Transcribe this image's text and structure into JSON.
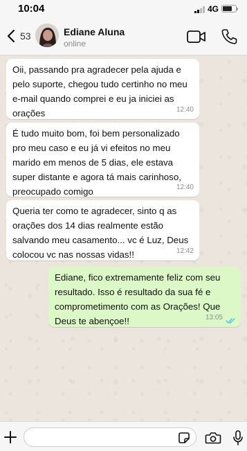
{
  "status_bar": {
    "time": "10:04",
    "network": "4G",
    "battery_level": 0.7
  },
  "header": {
    "back_count": "53",
    "contact_name": "Ediane Aluna",
    "contact_status": "online",
    "icons": [
      "chevron-left-icon",
      "video-camera-icon",
      "phone-icon"
    ]
  },
  "messages": [
    {
      "direction": "incoming",
      "text": "Oii, passando pra agradecer pela ajuda e pelo suporte, chegou tudo certinho no meu e-mail quando comprei e eu ja iniciei as orações",
      "time": "12:40"
    },
    {
      "direction": "incoming",
      "text": "É tudo muito bom, foi bem personalizado pro meu caso e eu já vi efeitos no meu marido em menos de 5 dias, ele estava super distante e agora tá mais carinhoso, preocupado comigo",
      "time": "12:40"
    },
    {
      "direction": "incoming",
      "text": "Queria ter como te agradecer, sinto q as orações dos 14 dias realmente estão salvando meu casamento... vc é Luz, Deus colocou vc nas nossas vidas!!",
      "time": "12:42"
    },
    {
      "direction": "outgoing",
      "text": "Ediane, fico extremamente feliz com seu resultado. Isso é resultado da sua fé e comprometimento com as Orações! Que Deus te abençoe!!",
      "time": "13:05",
      "read": true
    }
  ],
  "input_bar": {
    "placeholder": "",
    "icons": [
      "plus-icon",
      "sticker-icon",
      "camera-icon",
      "microphone-icon"
    ]
  },
  "colors": {
    "incoming_bubble": "#ffffff",
    "outgoing_bubble": "#dcf8c6",
    "chat_background": "#ece5dd",
    "read_ticks": "#4fc3f7",
    "accent": "#007aff"
  }
}
